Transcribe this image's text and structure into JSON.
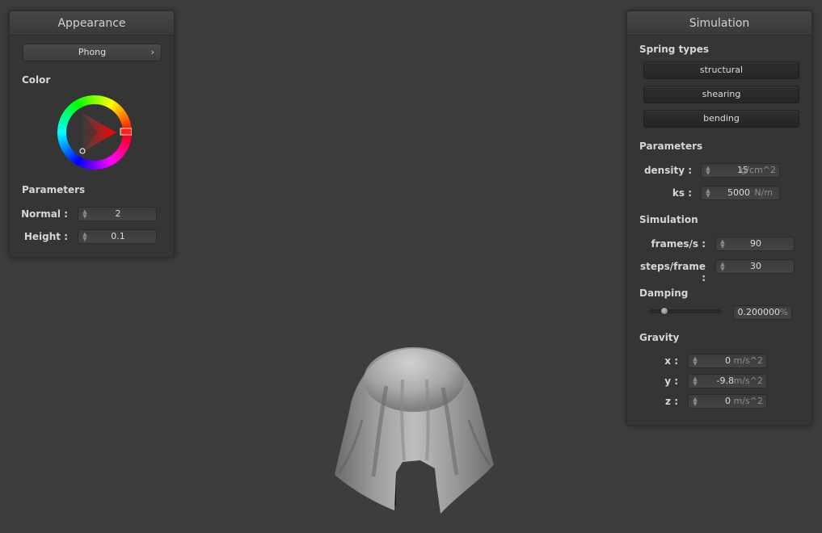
{
  "appearance": {
    "title": "Appearance",
    "shader_label": "Phong",
    "shader_chevron": "›",
    "color_label": "Color",
    "parameters_label": "Parameters",
    "normal_label": "Normal :",
    "normal_value": "2",
    "height_label": "Height :",
    "height_value": "0.1",
    "selected_hue": "#ff0000"
  },
  "simulation": {
    "title": "Simulation",
    "spring_types_label": "Spring types",
    "spring_buttons": [
      "structural",
      "shearing",
      "bending"
    ],
    "parameters_label": "Parameters",
    "density_label": "density :",
    "density_value": "15",
    "density_unit": "g/cm^2",
    "ks_label": "ks :",
    "ks_value": "5000",
    "ks_unit": "N/m",
    "simulation_label": "Simulation",
    "fps_label": "frames/s :",
    "fps_value": "90",
    "steps_label": "steps/frame :",
    "steps_value": "30",
    "damping_label": "Damping",
    "damping_value": "0.200000",
    "damping_unit": "%",
    "damping_fraction": 0.2,
    "gravity_label": "Gravity",
    "gx_label": "x :",
    "gx_value": "0",
    "gy_label": "y :",
    "gy_value": "-9.8",
    "gz_label": "z :",
    "gz_value": "0",
    "gravity_unit": "m/s^2"
  },
  "scene": {
    "background": "#3d3d3d",
    "cloth_color": "#9a9a9a"
  }
}
